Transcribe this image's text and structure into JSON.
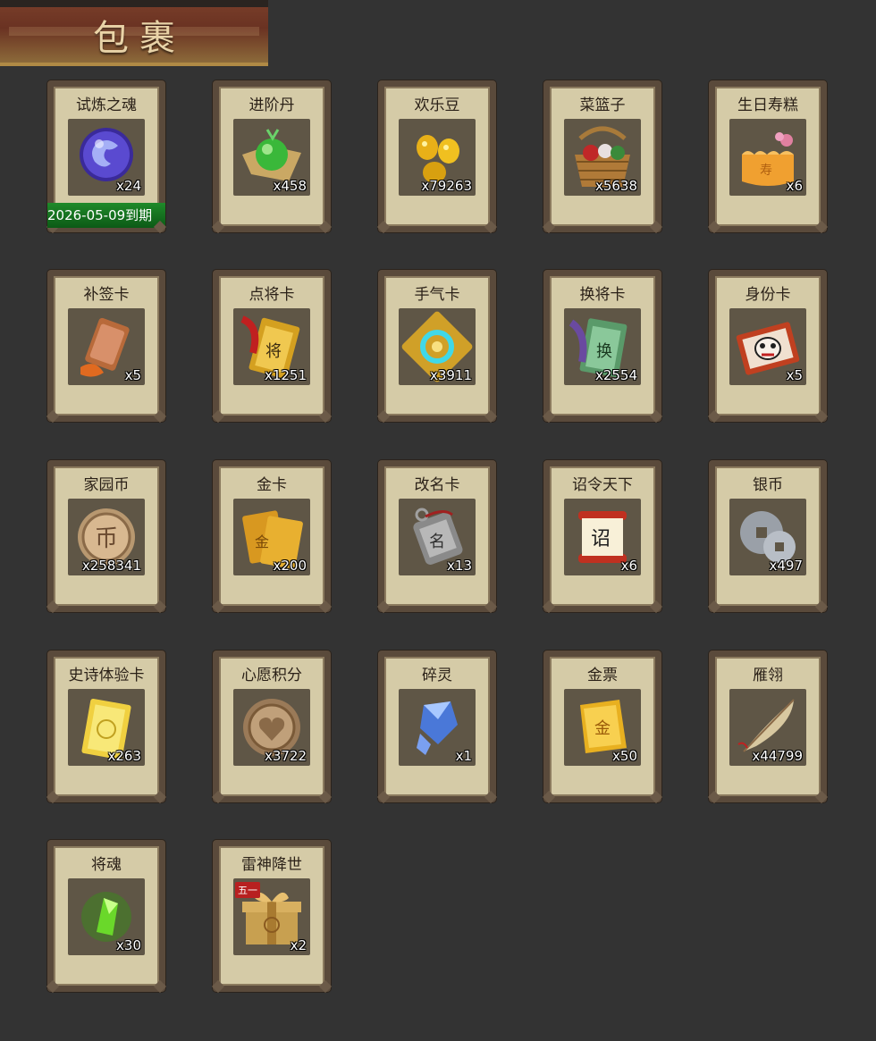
{
  "header": {
    "title": "包裹"
  },
  "items": [
    {
      "name": "试炼之魂",
      "count": "x24",
      "icon": "purple-dragon-orb-icon",
      "expiry": "2026-05-09到期"
    },
    {
      "name": "进阶丹",
      "count": "x458",
      "icon": "green-pill-icon"
    },
    {
      "name": "欢乐豆",
      "count": "x79263",
      "icon": "gold-beans-icon"
    },
    {
      "name": "菜篮子",
      "count": "x5638",
      "icon": "vegetable-basket-icon"
    },
    {
      "name": "生日寿糕",
      "count": "x6",
      "icon": "birthday-cake-icon"
    },
    {
      "name": "补签卡",
      "count": "x5",
      "icon": "copper-tag-icon"
    },
    {
      "name": "点将卡",
      "count": "x1251",
      "icon": "general-card-icon"
    },
    {
      "name": "手气卡",
      "count": "x3911",
      "icon": "luck-card-icon"
    },
    {
      "name": "换将卡",
      "count": "x2554",
      "icon": "swap-general-card-icon"
    },
    {
      "name": "身份卡",
      "count": "x5",
      "icon": "identity-mask-card-icon"
    },
    {
      "name": "家园币",
      "count": "x258341",
      "icon": "home-coin-icon"
    },
    {
      "name": "金卡",
      "count": "x200",
      "icon": "gold-card-icon"
    },
    {
      "name": "改名卡",
      "count": "x13",
      "icon": "rename-tag-icon"
    },
    {
      "name": "诏令天下",
      "count": "x6",
      "icon": "imperial-scroll-icon"
    },
    {
      "name": "银币",
      "count": "x497",
      "icon": "silver-coins-icon"
    },
    {
      "name": "史诗体验卡",
      "count": "x263",
      "icon": "epic-trial-card-icon"
    },
    {
      "name": "心愿积分",
      "count": "x3722",
      "icon": "heart-coin-icon"
    },
    {
      "name": "碎灵",
      "count": "x1",
      "icon": "blue-crystal-shard-icon"
    },
    {
      "name": "金票",
      "count": "x50",
      "icon": "gold-ticket-icon"
    },
    {
      "name": "雁翎",
      "count": "x44799",
      "icon": "feather-quill-icon"
    },
    {
      "name": "将魂",
      "count": "x30",
      "icon": "green-soul-crystal-icon"
    },
    {
      "name": "雷神降世",
      "count": "x2",
      "icon": "gift-box-icon",
      "badge": "五一"
    }
  ],
  "colors": {
    "background": "#333333",
    "card": "#d5cba7",
    "frame": "#5a4a3b",
    "expiry_bar": "#1f8a2a"
  }
}
